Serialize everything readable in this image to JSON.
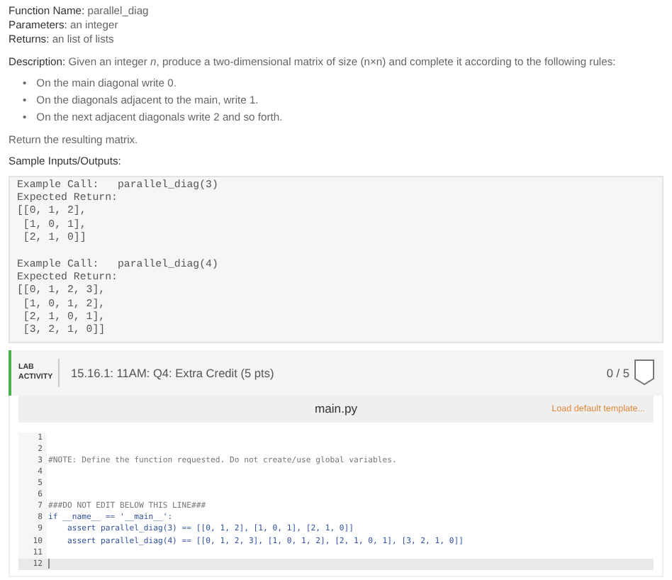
{
  "header": [
    "**Function Name:** parallel_diag",
    "**Parameters:** an integer",
    "**Returns:** an list of lists"
  ],
  "description": "**Description:** Given an integer *n*, produce a two-dimensional matrix of size (n×n) and complete it according to the following rules:",
  "rules": [
    {
      "marker": "•",
      "text": "On the main diagonal write 0."
    },
    {
      "marker": "•",
      "text": "On the diagonals adjacent to the main, write 1."
    },
    {
      "marker": "•",
      "text": "On the next adjacent diagonals write 2 and so forth."
    }
  ],
  "closing": "Return the resulting matrix.",
  "samples_heading": "Sample Inputs/Outputs:",
  "sample_code": "Example Call:   parallel_diag(3)\nExpected Return:\n[[0, 1, 2],\n [1, 0, 1],\n [2, 1, 0]]\n\nExample Call:   parallel_diag(4)\nExpected Return:\n[[0, 1, 2, 3],\n [1, 0, 1, 2],\n [2, 1, 0, 1],\n [3, 2, 1, 0]]",
  "lab": {
    "badge": "LAB ACTIVITY",
    "title": "15.16.1: 11AM: Q4: Extra Credit (5 pts)",
    "score": "0 / 5"
  },
  "editor": {
    "filename": "main.py",
    "load_link": "Load default template...",
    "lines": [
      {
        "number": "1",
        "kind": "blank",
        "active": false
      },
      {
        "number": "2",
        "kind": "blank",
        "active": false
      },
      {
        "number": "3",
        "kind": "comment",
        "text": "#NOTE: Define the function requested. Do not create/use global variables.",
        "active": false
      },
      {
        "number": "4",
        "kind": "blank",
        "active": false
      },
      {
        "number": "5",
        "kind": "blank",
        "active": false
      },
      {
        "number": "6",
        "kind": "blank",
        "active": false
      },
      {
        "number": "7",
        "kind": "comment",
        "text": "###DO NOT EDIT BELOW THIS LINE###",
        "active": false
      },
      {
        "number": "8",
        "kind": "code",
        "text": "if __name__ == '__main__':",
        "active": false
      },
      {
        "number": "9",
        "kind": "code",
        "text": "    assert parallel_diag(3) == [[0, 1, 2], [1, 0, 1], [2, 1, 0]]",
        "active": false
      },
      {
        "number": "10",
        "kind": "code",
        "text": "    assert parallel_diag(4) == [[0, 1, 2, 3], [1, 0, 1, 2], [2, 1, 0, 1], [3, 2, 1, 0]]",
        "active": false
      },
      {
        "number": "11",
        "kind": "blank",
        "active": false
      },
      {
        "number": "12",
        "kind": "blank",
        "active": true
      }
    ]
  }
}
